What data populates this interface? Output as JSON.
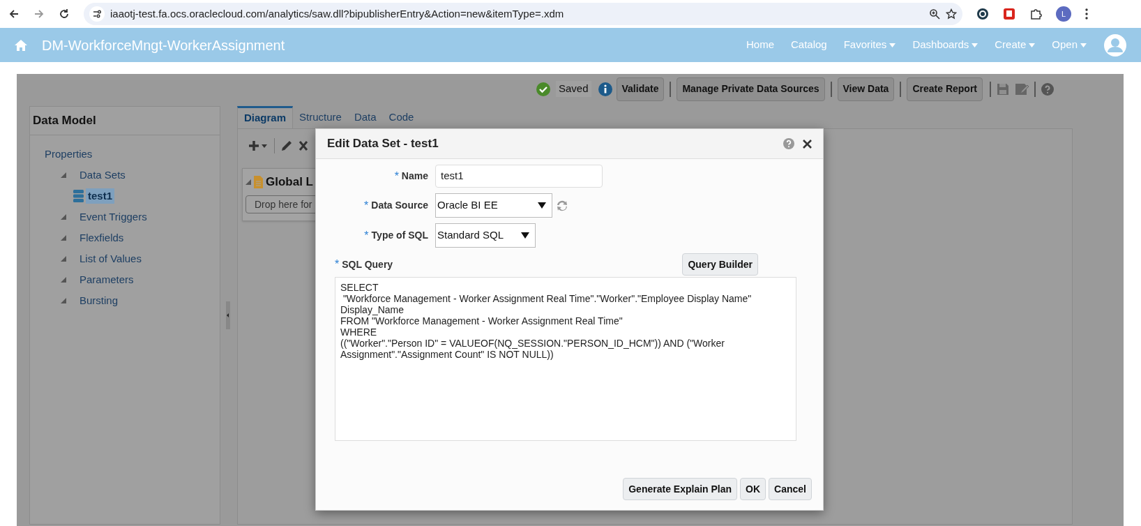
{
  "browser": {
    "url": "iaaotj-test.fa.ocs.oraclecloud.com/analytics/saw.dll?bipublisherEntry&Action=new&itemType=.xdm",
    "profile_initial": "L"
  },
  "header": {
    "title": "DM-WorkforceMngt-WorkerAssignment",
    "nav": [
      {
        "label": "Home",
        "dropdown": false
      },
      {
        "label": "Catalog",
        "dropdown": false
      },
      {
        "label": "Favorites",
        "dropdown": true
      },
      {
        "label": "Dashboards",
        "dropdown": true
      },
      {
        "label": "Create",
        "dropdown": true
      },
      {
        "label": "Open",
        "dropdown": true
      }
    ]
  },
  "toolbar": {
    "status": "Saved",
    "buttons": [
      "Validate",
      "Manage Private Data Sources",
      "View Data",
      "Create Report"
    ]
  },
  "data_model": {
    "title": "Data Model",
    "tree": [
      {
        "label": "Properties",
        "selected": false,
        "children": [
          {
            "label": "Data Sets",
            "selected": false,
            "children": [
              {
                "label": "test1",
                "selected": true
              }
            ]
          },
          {
            "label": "Event Triggers",
            "selected": false
          },
          {
            "label": "Flexfields",
            "selected": false
          },
          {
            "label": "List of Values",
            "selected": false
          },
          {
            "label": "Parameters",
            "selected": false
          },
          {
            "label": "Bursting",
            "selected": false
          }
        ]
      }
    ]
  },
  "tabs": [
    {
      "label": "Diagram",
      "selected": true
    },
    {
      "label": "Structure",
      "selected": false
    },
    {
      "label": "Data",
      "selected": false
    },
    {
      "label": "Code",
      "selected": false
    }
  ],
  "canvas": {
    "group_title": "Global L",
    "drop_text": "Drop here for"
  },
  "dialog": {
    "title": "Edit Data Set - test1",
    "fields": [
      {
        "kind": "text",
        "required_mark": "*",
        "label": "Name",
        "value": "test1"
      },
      {
        "kind": "select",
        "required_mark": "*",
        "label": "Data Source",
        "value": "Oracle BI EE",
        "refresh": true
      },
      {
        "kind": "select",
        "required_mark": "*",
        "label": "Type of SQL",
        "value": "Standard SQL",
        "refresh": false
      }
    ],
    "sql_required_mark": "*",
    "sql_label": "SQL Query",
    "query_builder": "Query Builder",
    "sql": "SELECT\n \"Workforce Management - Worker Assignment Real Time\".\"Worker\".\"Employee Display Name\"\nDisplay_Name\nFROM \"Workforce Management - Worker Assignment Real Time\"\nWHERE\n((\"Worker\".\"Person ID\" = VALUEOF(NQ_SESSION.\"PERSON_ID_HCM\")) AND (\"Worker\nAssignment\".\"Assignment Count\" IS NOT NULL))",
    "buttons": [
      "Generate Explain Plan",
      "OK",
      "Cancel"
    ]
  }
}
